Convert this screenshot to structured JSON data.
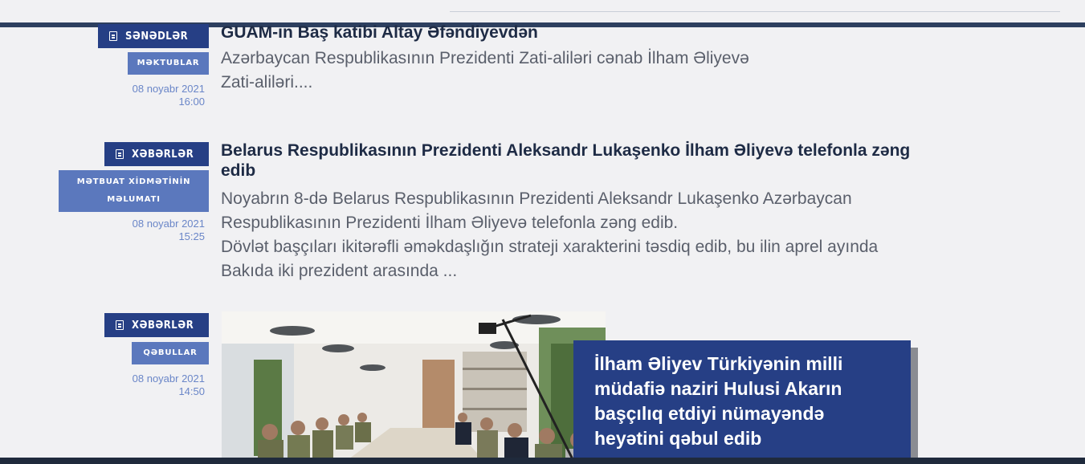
{
  "entries": [
    {
      "category": "SƏNƏDLƏR",
      "subcategory": "MƏKTUBLAR",
      "date": "08 noyabr 2021",
      "time": "16:00",
      "headline": "GUAM-ın Baş katibi Altay Əfəndiyevdən",
      "excerpt_lines": [
        "Azərbaycan Respublikasının Prezidenti Zati-aliləri cənab İlham Əliyevə",
        "Zati-aliləri...."
      ]
    },
    {
      "category": "XƏBƏRLƏR",
      "subcategory_lines": [
        "MƏTBUAT XİDMƏTİNİN",
        "MƏLUMATI"
      ],
      "date": "08 noyabr 2021",
      "time": "15:25",
      "headline_lines": [
        "Belarus Respublikasının Prezidenti Aleksandr Lukaşenko İlham Əliyevə telefonla zəng",
        "edib"
      ],
      "excerpt_lines": [
        "Noyabrın 8-də Belarus Respublikasının Prezidenti Aleksandr Lukaşenko Azərbaycan",
        "Respublikasının Prezidenti İlham Əliyevə telefonla zəng edib.",
        "Dövlət başçıları ikitərəfli əməkdaşlığın strateji xarakterini təsdiq edib, bu ilin aprel ayında",
        "Bakıda iki prezident arasında ..."
      ]
    },
    {
      "category": "XƏBƏRLƏR",
      "subcategory": "QƏBULLAR",
      "date": "08 noyabr 2021",
      "time": "14:50",
      "caption_lines": [
        "İlham Əliyev Türkiyənin milli",
        "müdafiə naziri Hulusi Akarın",
        "başçılıq etdiyi nümayəndə",
        "heyətini qəbul edib"
      ]
    }
  ],
  "colors": {
    "category_bg": "#263f85",
    "subcategory_bg": "#5b78bd",
    "date_text": "#6a86c8",
    "headline_text": "#1e2b45",
    "excerpt_text": "#5a5f6b",
    "page_bg": "#f1f1f3"
  }
}
